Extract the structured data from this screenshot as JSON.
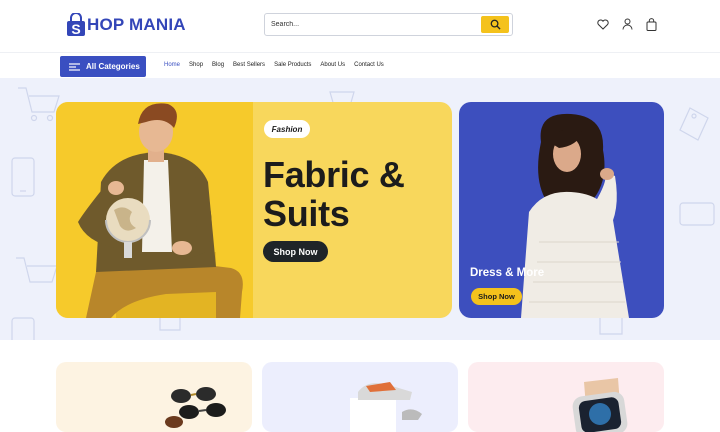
{
  "brand": {
    "logo_letter": "S",
    "logo_text": "HOP MANIA",
    "color": "#3346b8"
  },
  "search": {
    "placeholder": "Search...",
    "value": ""
  },
  "header_icons": [
    "heart-icon",
    "user-icon",
    "shopping-bag-icon"
  ],
  "nav": {
    "categories_label": "All Categories",
    "links": [
      "Home",
      "Shop",
      "Blog",
      "Best Sellers",
      "Sale Products",
      "About Us",
      "Contact Us"
    ],
    "active": "Home"
  },
  "hero": {
    "tag": "Fashion",
    "headline_line1": "Fabric &",
    "headline_line2": "Suits",
    "cta": "Shop Now"
  },
  "side_banner": {
    "title": "Dress & More",
    "cta": "Shop Now"
  },
  "colors": {
    "accent": "#3a4fc1",
    "yellow": "#f4c21c",
    "banner_bg": "#f8d75c",
    "side_bg": "#3d4fbe",
    "hero_area": "#eef1fb"
  },
  "category_cards": [
    {
      "image": "sunglasses"
    },
    {
      "image": "sneakers"
    },
    {
      "image": "smartwatch"
    }
  ]
}
